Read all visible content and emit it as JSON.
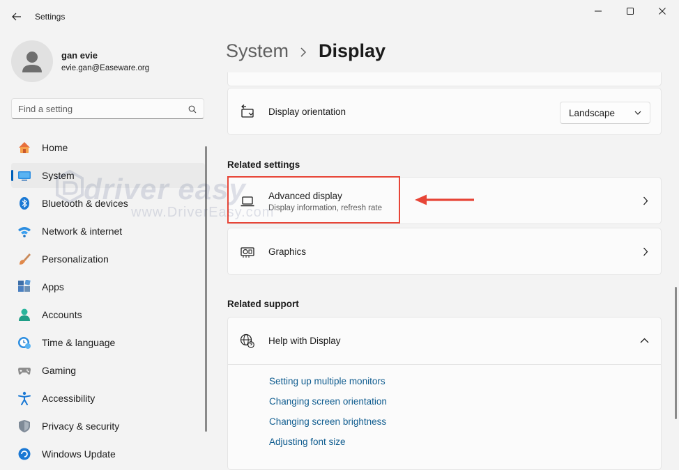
{
  "app": {
    "title": "Settings",
    "accent_color": "#005fb8",
    "highlight_color": "#e74537"
  },
  "profile": {
    "name": "gan evie",
    "email": "evie.gan@Easeware.org"
  },
  "search": {
    "placeholder": "Find a setting",
    "icon": "search-icon"
  },
  "nav": {
    "items": [
      {
        "label": "Home",
        "icon": "home-icon"
      },
      {
        "label": "System",
        "icon": "system-icon",
        "selected": true
      },
      {
        "label": "Bluetooth & devices",
        "icon": "bluetooth-icon"
      },
      {
        "label": "Network & internet",
        "icon": "wifi-icon"
      },
      {
        "label": "Personalization",
        "icon": "brush-icon"
      },
      {
        "label": "Apps",
        "icon": "apps-icon"
      },
      {
        "label": "Accounts",
        "icon": "accounts-icon"
      },
      {
        "label": "Time & language",
        "icon": "clock-globe-icon"
      },
      {
        "label": "Gaming",
        "icon": "gamepad-icon"
      },
      {
        "label": "Accessibility",
        "icon": "accessibility-icon"
      },
      {
        "label": "Privacy & security",
        "icon": "shield-icon"
      },
      {
        "label": "Windows Update",
        "icon": "update-icon"
      }
    ]
  },
  "breadcrumb": {
    "parent": "System",
    "current": "Display"
  },
  "orientation": {
    "label": "Display orientation",
    "value": "Landscape"
  },
  "related_settings": {
    "heading": "Related settings",
    "advanced": {
      "title": "Advanced display",
      "subtitle": "Display information, refresh rate"
    },
    "graphics": {
      "title": "Graphics"
    }
  },
  "related_support": {
    "heading": "Related support",
    "help_title": "Help with Display",
    "expanded": true,
    "links": [
      "Setting up multiple monitors",
      "Changing screen orientation",
      "Changing screen brightness",
      "Adjusting font size"
    ]
  },
  "watermark": {
    "main": "driver easy",
    "sub": "www.DriverEasy.com"
  }
}
